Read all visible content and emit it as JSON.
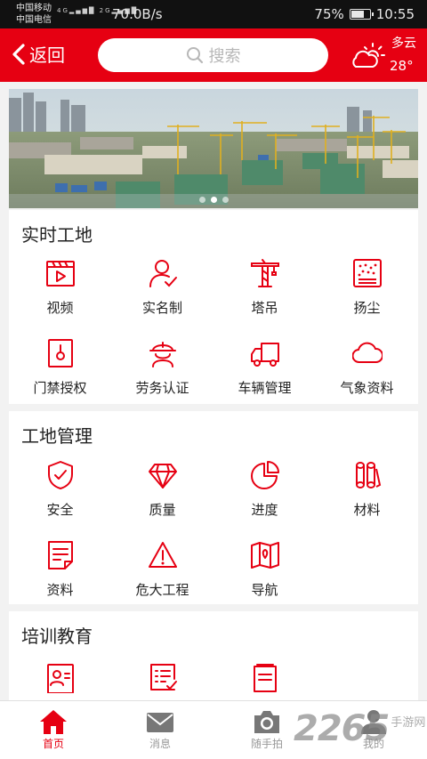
{
  "status_bar": {
    "carrier_1": "中国移动",
    "carrier_2": "中国电信",
    "signal_1": "4G",
    "signal_2": "2G",
    "net_speed": "70.0B/s",
    "battery": "75%",
    "battery_level": 0.75,
    "time": "10:55"
  },
  "header": {
    "back_label": "返回",
    "search_placeholder": "搜索",
    "weather_condition": "多云",
    "weather_temp": "28°",
    "weather_icon": "partly-cloudy-icon"
  },
  "banner": {
    "image": "construction-site-aerial-photo",
    "slide_count": 3,
    "active_slide": 2
  },
  "sections": [
    {
      "title": "实时工地",
      "items": [
        {
          "label": "视频",
          "icon": "video-icon"
        },
        {
          "label": "实名制",
          "icon": "user-check-icon"
        },
        {
          "label": "塔吊",
          "icon": "tower-crane-icon"
        },
        {
          "label": "扬尘",
          "icon": "dust-icon"
        },
        {
          "label": "门禁授权",
          "icon": "access-control-icon"
        },
        {
          "label": "劳务认证",
          "icon": "worker-helmet-icon"
        },
        {
          "label": "车辆管理",
          "icon": "truck-icon"
        },
        {
          "label": "气象资料",
          "icon": "cloud-icon"
        }
      ]
    },
    {
      "title": "工地管理",
      "items": [
        {
          "label": "安全",
          "icon": "shield-check-icon"
        },
        {
          "label": "质量",
          "icon": "diamond-icon"
        },
        {
          "label": "进度",
          "icon": "pie-chart-icon"
        },
        {
          "label": "材料",
          "icon": "materials-icon"
        },
        {
          "label": "资料",
          "icon": "document-icon"
        },
        {
          "label": "危大工程",
          "icon": "warning-icon"
        },
        {
          "label": "导航",
          "icon": "map-icon"
        }
      ]
    },
    {
      "title": "培训教育",
      "items": [
        {
          "label": "",
          "icon": "id-card-icon"
        },
        {
          "label": "",
          "icon": "checklist-icon"
        },
        {
          "label": "",
          "icon": "booklet-icon"
        }
      ]
    }
  ],
  "tabbar": [
    {
      "label": "首页",
      "icon": "home-icon",
      "active": true
    },
    {
      "label": "消息",
      "icon": "mail-icon",
      "active": false
    },
    {
      "label": "随手拍",
      "icon": "camera-icon",
      "active": false
    },
    {
      "label": "我的",
      "icon": "user-icon",
      "active": false
    }
  ],
  "watermark": {
    "number": "2265",
    "text": "手游网"
  },
  "colors": {
    "brand_red": "#e60012",
    "tab_inactive": "#999999",
    "background": "#f2f2f2"
  }
}
